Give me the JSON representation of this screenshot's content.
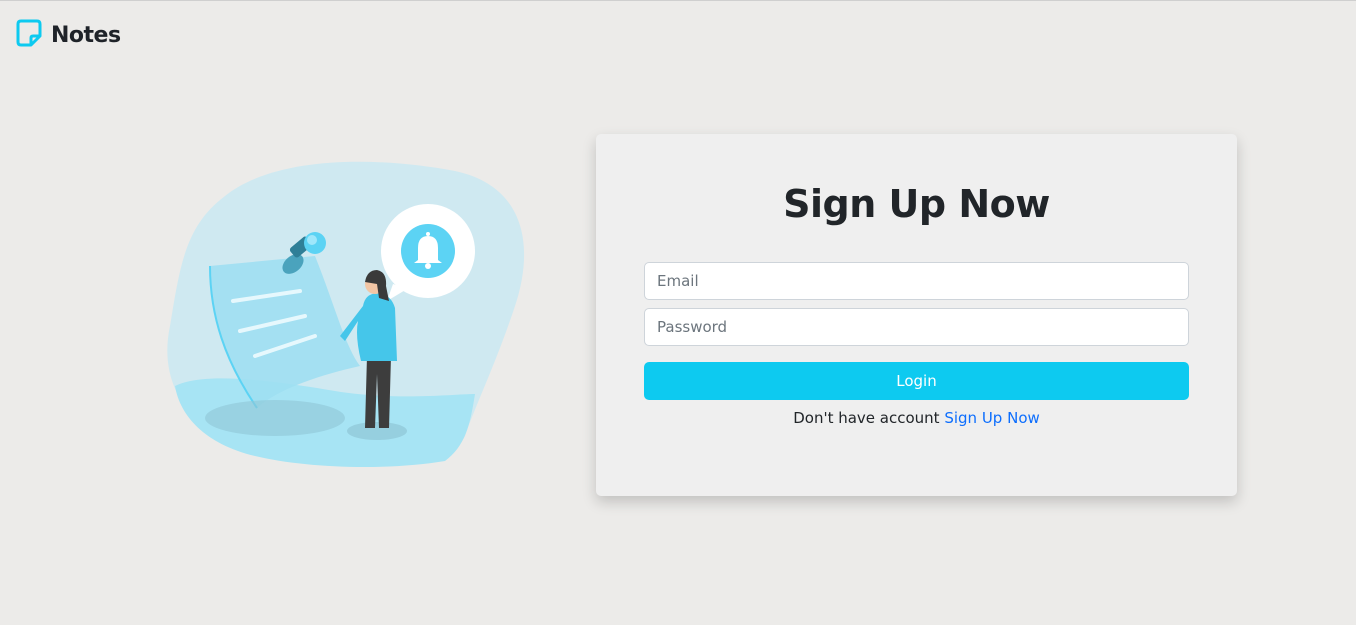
{
  "brand": {
    "title": "Notes",
    "icon": "sticky-note-icon",
    "accent": "#0dcaf0"
  },
  "illustration": {
    "icons": [
      "pushpin-icon",
      "bell-icon",
      "person-figure"
    ],
    "blob_color": "#cfe9f1",
    "accent": "#5cd3f4"
  },
  "form": {
    "title": "Sign Up Now",
    "email_placeholder": "Email",
    "password_placeholder": "Password",
    "login_label": "Login",
    "prompt_text": "Don't have account",
    "signup_link": "Sign Up Now",
    "button_color": "#0dcaf0",
    "link_color": "#0d6efd"
  }
}
